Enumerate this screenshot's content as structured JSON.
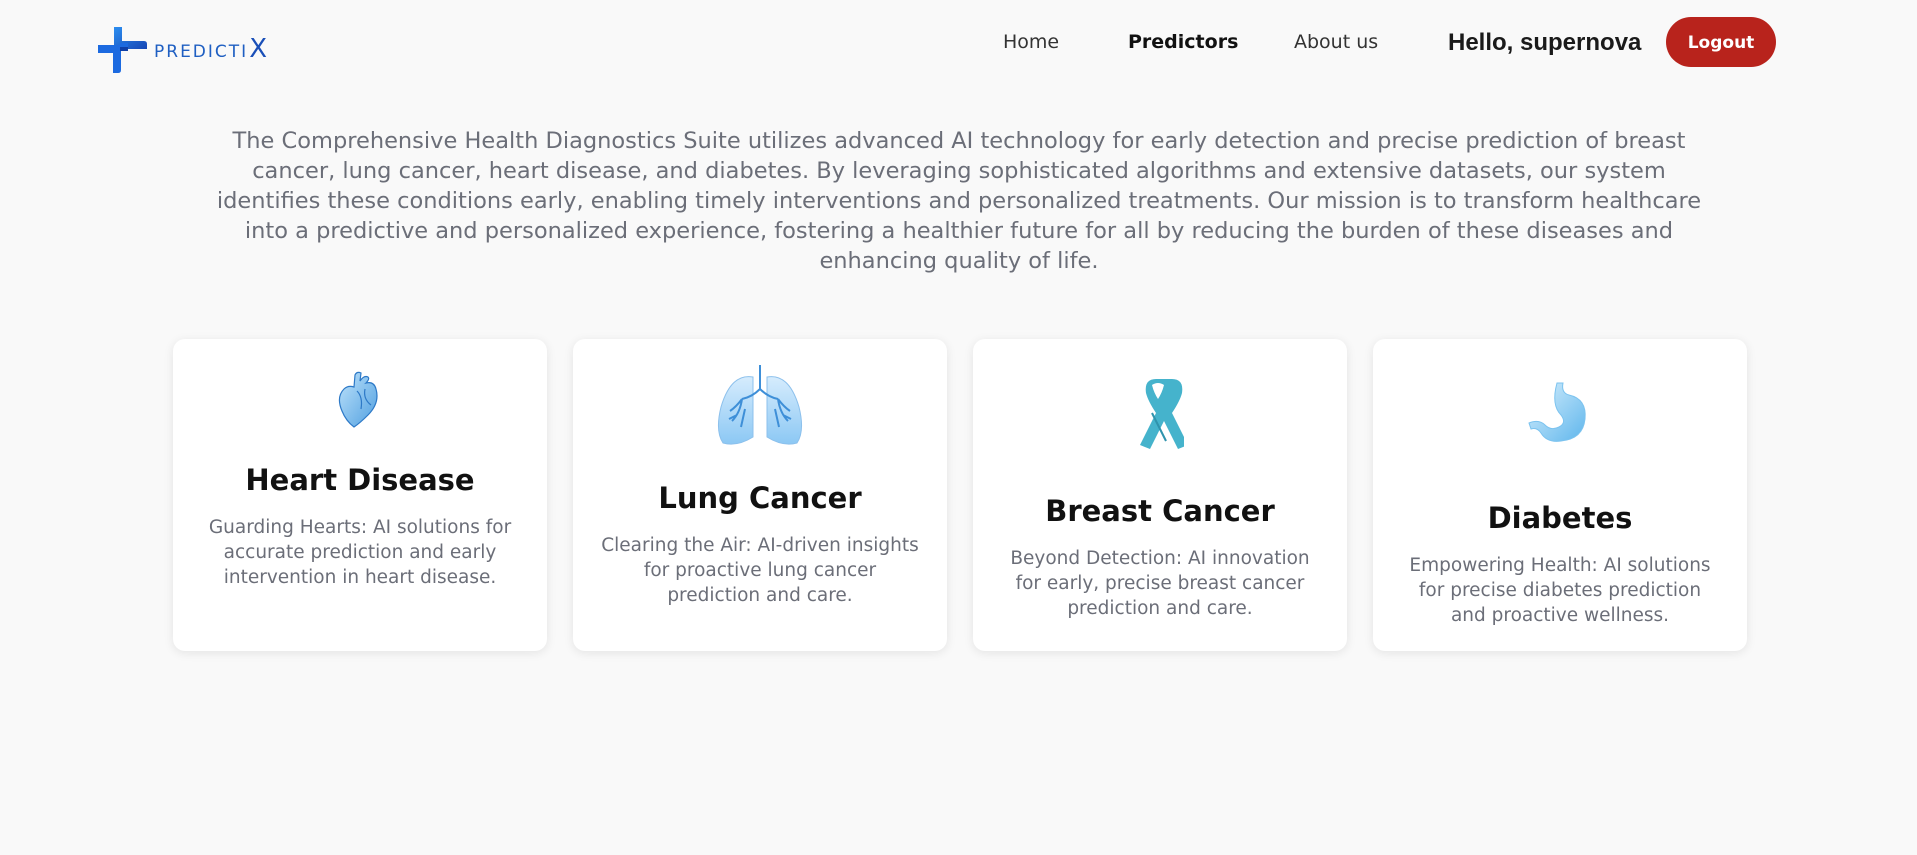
{
  "brand": {
    "name_main": "PREDICTI",
    "name_tail": "X"
  },
  "nav": {
    "links": [
      {
        "label": "Home",
        "active": false
      },
      {
        "label": "Predictors",
        "active": true
      },
      {
        "label": "About us",
        "active": false
      }
    ],
    "greeting": "Hello, supernova",
    "logout_label": "Logout"
  },
  "intro": "The Comprehensive Health Diagnostics Suite utilizes advanced AI technology for early detection and precise prediction of breast cancer, lung cancer, heart disease, and diabetes. By leveraging sophisticated algorithms and extensive datasets, our system identifies these conditions early, enabling timely interventions and personalized treatments. Our mission is to transform healthcare into a predictive and personalized experience, fostering a healthier future for all by reducing the burden of these diseases and enhancing quality of life.",
  "cards": [
    {
      "title": "Heart Disease",
      "description": "Guarding Hearts: AI solutions for accurate prediction and early intervention in heart disease.",
      "icon": "heart-icon"
    },
    {
      "title": "Lung Cancer",
      "description": "Clearing the Air: AI-driven insights for proactive lung cancer prediction and care.",
      "icon": "lungs-icon"
    },
    {
      "title": "Breast Cancer",
      "description": "Beyond Detection: AI innovation for early, precise breast cancer prediction and care.",
      "icon": "ribbon-icon"
    },
    {
      "title": "Diabetes",
      "description": "Empowering Health: AI solutions for precise diabetes prediction and proactive wellness.",
      "icon": "stomach-icon"
    }
  ],
  "colors": {
    "background": "#f9f9f9",
    "logout": "#b8231c",
    "brand": "#1f5fc2",
    "body_text": "#6b6e78"
  }
}
